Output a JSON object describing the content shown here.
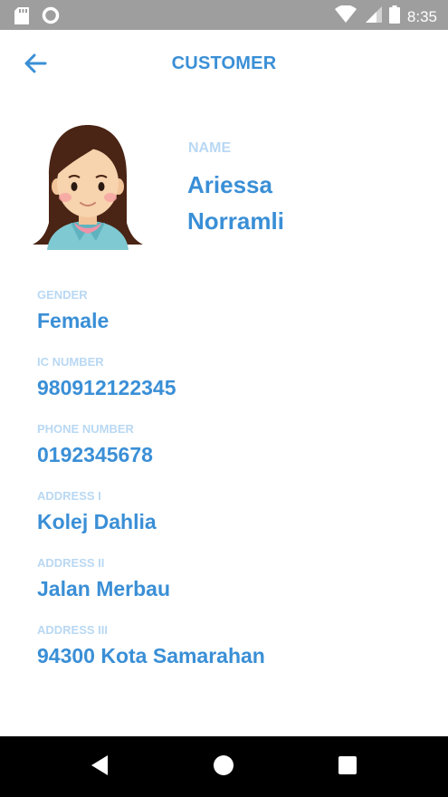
{
  "status_bar": {
    "time": "8:35",
    "icons": [
      "sd-card-icon",
      "circle-icon",
      "wifi-icon",
      "signal-icon",
      "battery-icon"
    ]
  },
  "app_bar": {
    "title": "CUSTOMER",
    "back_icon": "arrow-left-icon"
  },
  "profile": {
    "avatar_icon": "girl-avatar-icon",
    "name_label": "NAME",
    "first_name": "Ariessa",
    "last_name": "Norramli"
  },
  "fields": [
    {
      "label": "GENDER",
      "value": "Female"
    },
    {
      "label": "IC NUMBER",
      "value": "980912122345"
    },
    {
      "label": "PHONE NUMBER",
      "value": "0192345678"
    },
    {
      "label": "ADDRESS I",
      "value": "Kolej Dahlia"
    },
    {
      "label": "ADDRESS II",
      "value": "Jalan Merbau"
    },
    {
      "label": "ADDRESS III",
      "value": "94300 Kota Samarahan"
    }
  ],
  "nav_bar": {
    "icons": [
      "back-triangle-icon",
      "home-circle-icon",
      "recents-square-icon"
    ]
  },
  "colors": {
    "accent": "#3a8fd6",
    "label": "#b9d8f3",
    "status_bar": "#9e9e9e",
    "nav_bar": "#000000"
  }
}
